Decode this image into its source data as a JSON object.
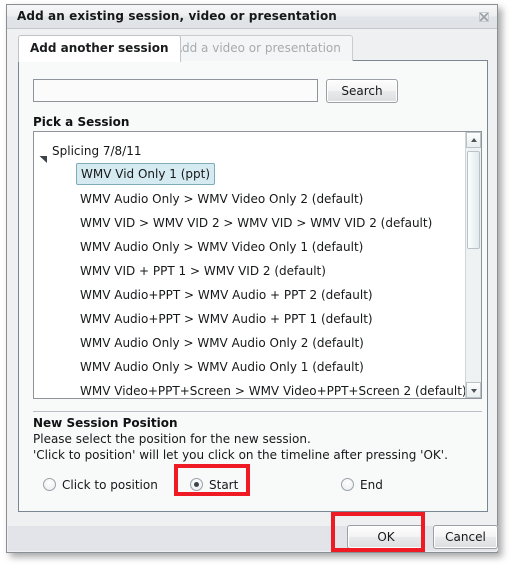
{
  "window": {
    "title": "Add an existing session, video or presentation",
    "close_icon": "close-icon"
  },
  "tabs": [
    {
      "label": "Add another session",
      "active": true
    },
    {
      "label": "Add a video or presentation",
      "active": false
    }
  ],
  "search": {
    "value": "",
    "placeholder": "",
    "button_label": "Search"
  },
  "list": {
    "label": "Pick a Session",
    "group": {
      "label": "Splicing 7/8/11",
      "expanded": true
    },
    "items": [
      {
        "label": "WMV Vid Only 1 (ppt)",
        "selected": true
      },
      {
        "label": "WMV Audio Only > WMV Video Only 2 (default)",
        "selected": false
      },
      {
        "label": "WMV VID > WMV VID 2 > WMV VID > WMV VID 2 (default)",
        "selected": false
      },
      {
        "label": "WMV Audio Only > WMV Video Only 1 (default)",
        "selected": false
      },
      {
        "label": "WMV VID + PPT 1 > WMV VID 2 (default)",
        "selected": false
      },
      {
        "label": "WMV Audio+PPT > WMV Audio + PPT 2 (default)",
        "selected": false
      },
      {
        "label": "WMV Audio+PPT > WMV Audio + PPT 1 (default)",
        "selected": false
      },
      {
        "label": "WMV Audio Only > WMV Audio Only 2 (default)",
        "selected": false
      },
      {
        "label": "WMV Audio Only > WMV Audio Only 1 (default)",
        "selected": false
      },
      {
        "label": "WMV Video+PPT+Screen > WMV Video+PPT+Screen 2 (default)",
        "selected": false
      }
    ],
    "scroll": {
      "up_icon": "chevron-up-icon",
      "down_icon": "chevron-down-icon"
    }
  },
  "position_section": {
    "title": "New Session Position",
    "line1": "Please select the position for the new session.",
    "line2": "'Click to position' will let you click on the timeline after pressing 'OK'.",
    "options": [
      {
        "label": "Click to position",
        "checked": false
      },
      {
        "label": "Start",
        "checked": true
      },
      {
        "label": "End",
        "checked": false
      }
    ]
  },
  "footer": {
    "ok_label": "OK",
    "cancel_label": "Cancel"
  },
  "annotations": {
    "color": "#ee1b24",
    "highlighted": [
      "Start",
      "OK"
    ]
  }
}
